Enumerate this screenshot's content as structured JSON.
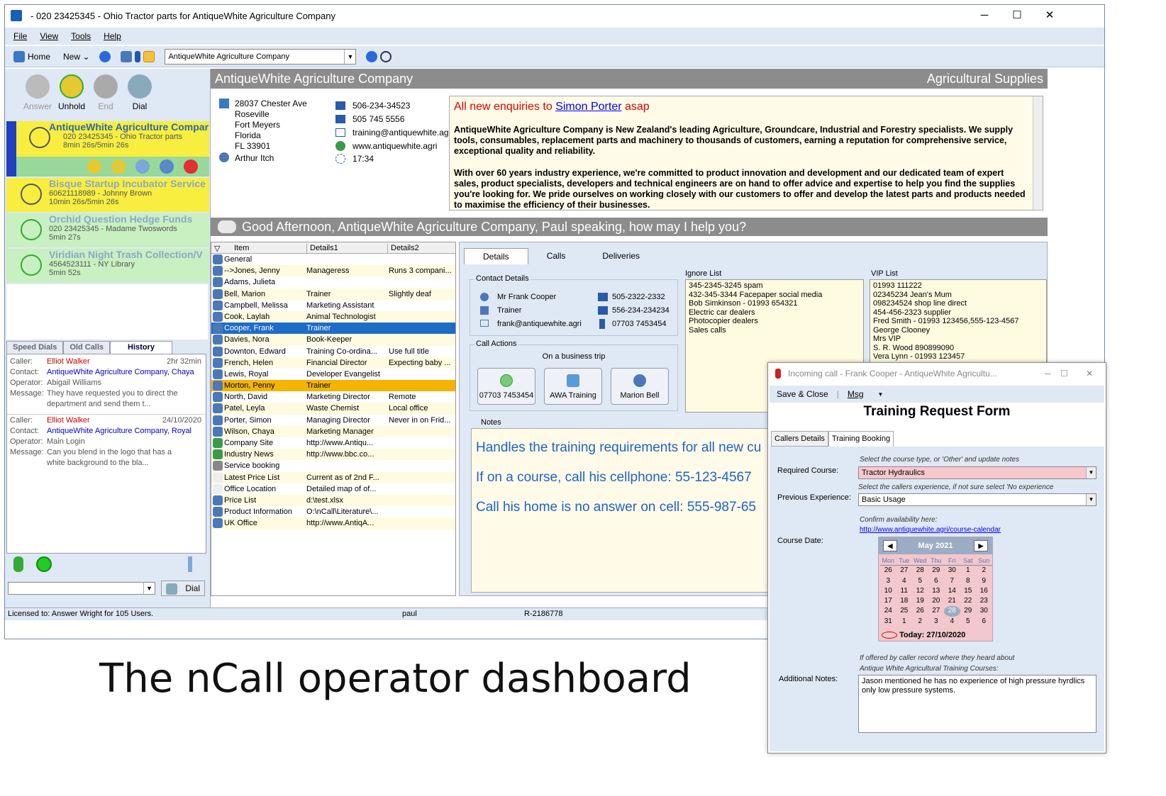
{
  "window": {
    "title": "- 020 23425345 - Ohio Tractor parts for AntiqueWhite Agriculture Company",
    "minimize": "─",
    "maximize": "☐",
    "close": "✕"
  },
  "menu": [
    "File",
    "View",
    "Tools",
    "Help"
  ],
  "toolbar": {
    "home": "Home",
    "new": "New",
    "company_combo": "AntiqueWhite Agriculture Company"
  },
  "call_buttons": {
    "answer": "Answer",
    "unhold": "Unhold",
    "end": "End",
    "dial": "Dial"
  },
  "calls": [
    {
      "name": "AntiqueWhite Agriculture Compar",
      "sub": "020 23425345 - Ohio Tractor parts",
      "dur": "8min 26s/5min 26s"
    },
    {
      "name": "Bisque Startup Incubator Service",
      "sub": "60621118989 - Johnny Brown",
      "dur": "10min 26s/5min 26s"
    },
    {
      "name": "Orchid Question Hedge Funds",
      "sub": "020 23425345 - Madame Twoswords",
      "dur": "5min 27s"
    },
    {
      "name": "Viridian Night Trash Collection/V",
      "sub": "4564523111 - NY Library",
      "dur": "5min 52s"
    }
  ],
  "left_tabs": [
    "Speed Dials",
    "Old Calls",
    "History"
  ],
  "history": [
    {
      "caller_k": "Caller:",
      "caller": "Elliot Walker",
      "when": "2hr 32min",
      "contact_k": "Contact:",
      "contact": "AntiqueWhite Agriculture Company, Chaya",
      "operator_k": "Operator:",
      "operator": "Abigail Williams",
      "message_k": "Message:",
      "message1": "They have requested you to direct the",
      "message2": "department and send them t..."
    },
    {
      "caller_k": "Caller:",
      "caller": "Elliot Walker",
      "when": "24/10/2020",
      "contact_k": "Contact:",
      "contact": "AntiqueWhite Agriculture Company, Royal",
      "operator_k": "Operator:",
      "operator": "Main Login",
      "message_k": "Message:",
      "message1": "Can you blend in the logo that has a",
      "message2": "white background to the bla..."
    }
  ],
  "dial_label": "Dial",
  "company": {
    "name": "AntiqueWhite Agriculture Company",
    "category": "Agricultural Supplies",
    "address": [
      "28037 Chester Ave",
      "Roseville",
      "Fort Meyers",
      "Florida",
      "FL 33901"
    ],
    "contact": "Arthur Itch",
    "phone1": "506-234-34523",
    "fax": "505 745 5556",
    "email": "training@antiquewhite.agri",
    "web": "www.antiquewhite.agri",
    "time": "17:34"
  },
  "notice": {
    "pre": "All new enquiries to ",
    "link": "Simon Porter",
    "post": " asap",
    "p1": "AntiqueWhite Agriculture Company is New Zealand's leading Agriculture, Groundcare, Industrial and Forestry specialists. We supply tools, consumables, replacement parts and machinery to thousands of customers, earning a reputation for comprehensive service, exceptional quality and reliability.",
    "p2": "With over 60 years industry experience, we're committed to product innovation and development and our dedicated team of expert sales, product specialists, developers and technical engineers are on hand to offer advice and expertise to help you find the supplies you're looking for. We pride ourselves on working closely with our customers to offer and develop the latest parts and products needed to maximise the efficiency of their businesses."
  },
  "greeting": "Good Afternoon, AntiqueWhite Agriculture Company,  Paul  speaking, how may I help you?",
  "list_headers": [
    "Item",
    "Details1",
    "Details2"
  ],
  "list": [
    [
      "General",
      "",
      ""
    ],
    [
      "-->Jones, Jenny",
      "Manageress",
      "Runs 3 compani..."
    ],
    [
      "Adams, Julieta",
      "",
      ""
    ],
    [
      "Bell, Marion",
      "Trainer",
      "Slightly deaf"
    ],
    [
      "Campbell, Melissa",
      "Marketing Assistant",
      ""
    ],
    [
      "Cook, Laylah",
      "Animal Technologist",
      ""
    ],
    [
      "Cooper, Frank",
      "Trainer",
      ""
    ],
    [
      "Davies, Nora",
      "Book-Keeper",
      ""
    ],
    [
      "Downton, Edward",
      "Training Co-ordina...",
      "Use full title"
    ],
    [
      "French, Helen",
      "Financial Director",
      "Expecting baby ..."
    ],
    [
      "Lewis, Royal",
      "Developer Evangelist",
      ""
    ],
    [
      "Morton, Penny",
      "Trainer",
      ""
    ],
    [
      "North, David",
      "Marketing Director",
      "Remote"
    ],
    [
      "Patel, Leyla",
      "Waste Chemist",
      "Local office"
    ],
    [
      "Porter, Simon",
      "Managing Director",
      "Never in on Frid..."
    ],
    [
      "Wilson, Chaya",
      "Marketing Manager",
      ""
    ],
    [
      "Company Site",
      "http://www.Antiqu...",
      ""
    ],
    [
      "Industry News",
      "http://www.bbc.co...",
      ""
    ],
    [
      "Service booking",
      "",
      ""
    ],
    [
      "Latest Price List",
      "Current as of 2nd F...",
      ""
    ],
    [
      "Office Location",
      "Detailed map of of...",
      ""
    ],
    [
      "Price List",
      "d:\\test.xlsx",
      ""
    ],
    [
      "Product Information",
      "O:\\nCall\\Literature\\...",
      ""
    ],
    [
      "UK Office",
      "http://www.AntiqA...",
      ""
    ]
  ],
  "right_tabs": [
    "Details",
    "Calls",
    "Deliveries"
  ],
  "contact_details": {
    "title": "Contact Details",
    "name": "Mr Frank Cooper",
    "role": "Trainer",
    "email": "frank@antiquewhite.agri",
    "tel1": "505-2322-2332",
    "tel2": "556-234-234234",
    "mobile": "07703 7453454"
  },
  "ignore_list": {
    "title": "Ignore List",
    "items": [
      "345-2345-3245 spam",
      "432-345-3344 Facepaper social media",
      "Bob Simkinson - 01993 654321",
      "Electric car dealers",
      "Photocopier dealers",
      "Sales calls"
    ]
  },
  "vip_list": {
    "title": "VIP List",
    "items": [
      "01993 111222",
      "02345234 Jean's Mum",
      "098234524 shop line direct",
      "454-456-2323 supplier",
      "Fred Smith - 01993 123456,555-123-4567",
      "George Clooney",
      "Mrs VIP",
      "S. R. Wood 890899090",
      "Vera Lynn - 01993 123457"
    ]
  },
  "call_actions": {
    "title": "Call Actions",
    "status": "On a business trip",
    "b1": "07703 7453454",
    "b2": "AWA Training",
    "b3": "Marion Bell"
  },
  "notes": {
    "title": "Notes",
    "l1": "Handles the training requirements for all new cu",
    "l2pre": "If on a course, call his cellphone:  ",
    "l2link": "55-123-4567",
    "l3pre": "Call his home is no answer on cell:  ",
    "l3link": "555-987-65"
  },
  "status": {
    "license": "Licensed to: Answer Wright for 105 Users.",
    "user": "paul",
    "ref": "R-2186778"
  },
  "caption": "The nCall operator dashboard",
  "form": {
    "title": "Incoming call - Frank Cooper - AntiqueWhite Agricultu...",
    "save": "Save & Close",
    "msg": "Msg",
    "heading": "Training Request Form",
    "tabs": [
      "Callers Details",
      "Training Booking"
    ],
    "course_hint": "Select the course type, or 'Other' and update notes",
    "course_label": "Required Course:",
    "course_value": "Tractor Hydraulics",
    "exp_hint": "Select the callers experience, if not sure select 'No experience",
    "exp_label": "Previous Experience:",
    "exp_value": "Basic Usage",
    "confirm_hint": "Confirm availability here:",
    "confirm_link": "http://www.antiquewhite.agri/course-calendar",
    "date_label": "Course Date:",
    "cal_month": "May 2021",
    "cal_days": [
      "Mon",
      "Tue",
      "Wed",
      "Thu",
      "Fri",
      "Sat",
      "Sun"
    ],
    "cal_weeks": [
      [
        "26",
        "27",
        "28",
        "29",
        "30",
        "1",
        "2"
      ],
      [
        "3",
        "4",
        "5",
        "6",
        "7",
        "8",
        "9"
      ],
      [
        "10",
        "11",
        "12",
        "13",
        "14",
        "15",
        "16"
      ],
      [
        "17",
        "18",
        "19",
        "20",
        "21",
        "22",
        "23"
      ],
      [
        "24",
        "25",
        "26",
        "27",
        "28",
        "29",
        "30"
      ],
      [
        "31",
        "1",
        "2",
        "3",
        "4",
        "5",
        "6"
      ]
    ],
    "cal_today": "Today: 27/10/2020",
    "notes_hint1": "If offered by caller record where they heard about",
    "notes_hint2": "Antique White Agricultural Training Courses:",
    "notes_label": "Additional Notes:",
    "notes_value": "Jason mentioned he has no experience of high pressure hyrdlics only low pressure systems."
  }
}
